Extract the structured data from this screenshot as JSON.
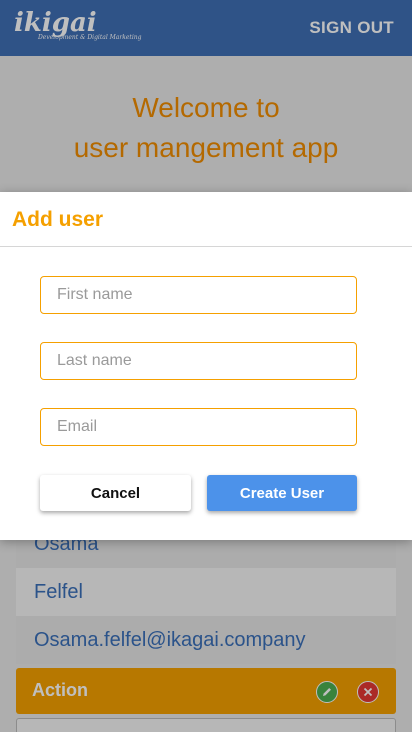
{
  "header": {
    "logo_word": "ikigai",
    "logo_tagline": "Development & Digital Marketing",
    "signout_label": "SIGN OUT"
  },
  "welcome": {
    "line1": "Welcome to",
    "line2": "user mangement app"
  },
  "user_card": {
    "first_name": "Osama",
    "last_name": "Felfel",
    "email": "Osama.felfel@ikagai.company",
    "action_label": "Action"
  },
  "dialog": {
    "title": "Add user",
    "first_name_placeholder": "First name",
    "last_name_placeholder": "Last name",
    "email_placeholder": "Email",
    "cancel_label": "Cancel",
    "create_label": "Create User"
  },
  "colors": {
    "appbar": "#3f6fb5",
    "accent_orange": "#f5a000",
    "primary_blue": "#4c92ea",
    "edit_green": "#4caf50",
    "delete_red": "#e53935"
  },
  "icons": {
    "edit": "pencil-icon",
    "delete": "close-icon"
  }
}
